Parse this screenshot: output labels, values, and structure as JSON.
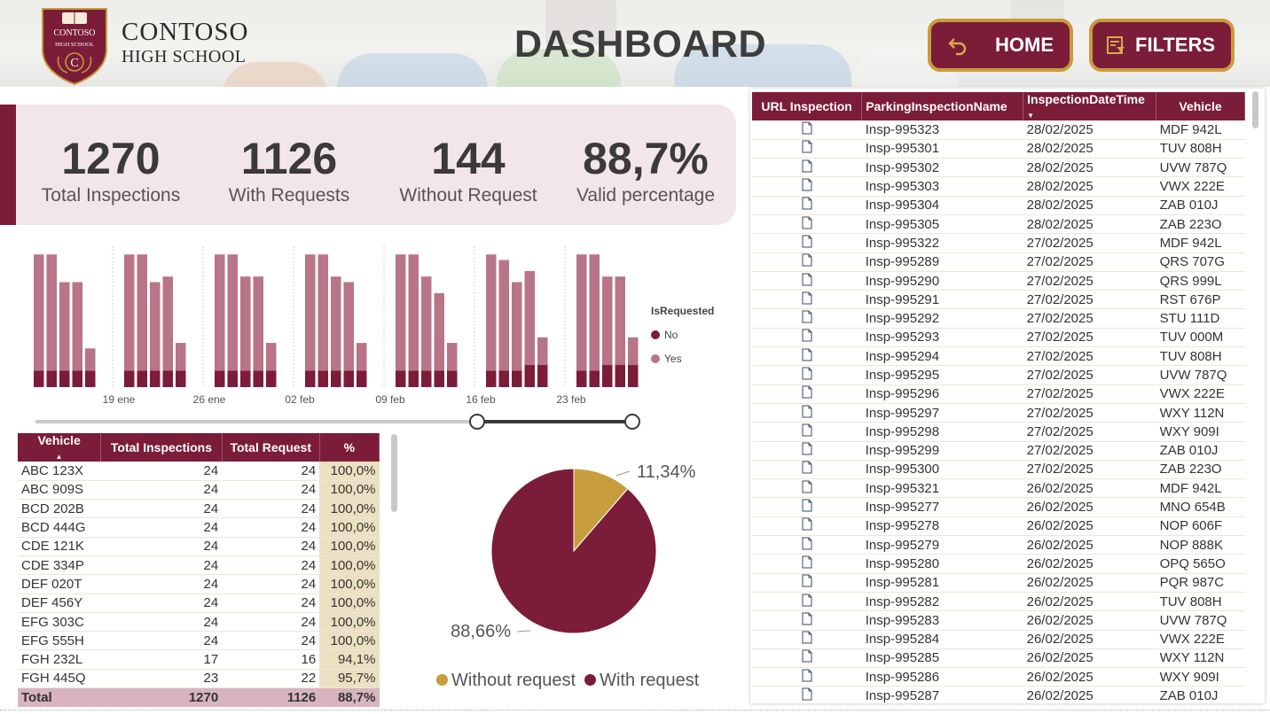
{
  "brand": {
    "line1": "CONTOSO",
    "line2": "HIGH SCHOOL",
    "crest_top": "CONTOSO",
    "crest_mid": "HIGH SCHOOL",
    "crest_letter": "C"
  },
  "header": {
    "title": "DASHBOARD",
    "home_label": "HOME",
    "filters_label": "FILTERS",
    "home_icon": "undo-arrow-icon",
    "filters_icon": "filter-icon"
  },
  "colors": {
    "maroon": "#7b1c38",
    "rose": "#b87587",
    "gold": "#c79d3e",
    "kpi_bg": "#f3e6e9",
    "pct_bg": "#ece0c2",
    "total_bg": "#d8b4bf"
  },
  "kpis": [
    {
      "value": "1270",
      "label": "Total Inspections"
    },
    {
      "value": "1126",
      "label": "With Requests"
    },
    {
      "value": "144",
      "label": "Without Request"
    },
    {
      "value": "88,7%",
      "label": "Valid percentage"
    }
  ],
  "bar_legend": {
    "title": "IsRequested",
    "items": [
      "No",
      "Yes"
    ]
  },
  "chart_data": [
    {
      "type": "bar",
      "stacked": true,
      "title": "",
      "legend_title": "IsRequested",
      "legend_position": "right",
      "x_tick_labels": [
        "19 ene",
        "26 ene",
        "02 feb",
        "09 feb",
        "16 feb",
        "23 feb"
      ],
      "groups": 7,
      "bars_per_group": 5,
      "series": [
        {
          "name": "No",
          "color": "#7b1c38",
          "values": [
            [
              3,
              3,
              3,
              3,
              3
            ],
            [
              3,
              3,
              3,
              3,
              3
            ],
            [
              3,
              3,
              3,
              3,
              3
            ],
            [
              3,
              3,
              3,
              3,
              3
            ],
            [
              3,
              3,
              3,
              3,
              3
            ],
            [
              3,
              3,
              3,
              4,
              4
            ],
            [
              3,
              3,
              4,
              4,
              4
            ]
          ]
        },
        {
          "name": "Yes",
          "color": "#b87587",
          "values": [
            [
              21,
              21,
              16,
              16,
              4
            ],
            [
              21,
              21,
              16,
              17,
              5
            ],
            [
              21,
              21,
              17,
              17,
              5
            ],
            [
              21,
              21,
              17,
              16,
              5
            ],
            [
              21,
              21,
              17,
              14,
              5
            ],
            [
              21,
              20,
              16,
              17,
              5
            ],
            [
              21,
              21,
              16,
              16,
              5
            ]
          ]
        }
      ],
      "ylim": [
        0,
        25
      ],
      "grid": false
    },
    {
      "type": "pie",
      "title": "",
      "slices": [
        {
          "name": "Without request",
          "value": 11.34,
          "label": "11,34%",
          "color": "#c79d3e"
        },
        {
          "name": "With request",
          "value": 88.66,
          "label": "88,66%",
          "color": "#7b1c38"
        }
      ],
      "legend_position": "bottom"
    }
  ],
  "vehicle_table": {
    "columns": [
      "Vehicle",
      "Total Inspections",
      "Total Request",
      "%"
    ],
    "rows": [
      [
        "ABC 123X",
        "24",
        "24",
        "100,0%"
      ],
      [
        "ABC 909S",
        "24",
        "24",
        "100,0%"
      ],
      [
        "BCD 202B",
        "24",
        "24",
        "100,0%"
      ],
      [
        "BCD 444G",
        "24",
        "24",
        "100,0%"
      ],
      [
        "CDE 121K",
        "24",
        "24",
        "100,0%"
      ],
      [
        "CDE 334P",
        "24",
        "24",
        "100,0%"
      ],
      [
        "DEF 020T",
        "24",
        "24",
        "100,0%"
      ],
      [
        "DEF 456Y",
        "24",
        "24",
        "100,0%"
      ],
      [
        "EFG 303C",
        "24",
        "24",
        "100,0%"
      ],
      [
        "EFG 555H",
        "24",
        "24",
        "100,0%"
      ],
      [
        "FGH 232L",
        "17",
        "16",
        "94,1%"
      ],
      [
        "FGH 445Q",
        "23",
        "22",
        "95,7%"
      ]
    ],
    "total": [
      "Total",
      "1270",
      "1126",
      "88,7%"
    ]
  },
  "inspection_table": {
    "columns": [
      "URL Inspection",
      "ParkingInspectionName",
      "InspectionDateTime",
      "Vehicle"
    ],
    "rows": [
      [
        "Insp-995323",
        "28/02/2025",
        "MDF 942L"
      ],
      [
        "Insp-995301",
        "28/02/2025",
        "TUV 808H"
      ],
      [
        "Insp-995302",
        "28/02/2025",
        "UVW 787Q"
      ],
      [
        "Insp-995303",
        "28/02/2025",
        "VWX 222E"
      ],
      [
        "Insp-995304",
        "28/02/2025",
        "ZAB 010J"
      ],
      [
        "Insp-995305",
        "28/02/2025",
        "ZAB 223O"
      ],
      [
        "Insp-995322",
        "27/02/2025",
        "MDF 942L"
      ],
      [
        "Insp-995289",
        "27/02/2025",
        "QRS 707G"
      ],
      [
        "Insp-995290",
        "27/02/2025",
        "QRS 999L"
      ],
      [
        "Insp-995291",
        "27/02/2025",
        "RST 676P"
      ],
      [
        "Insp-995292",
        "27/02/2025",
        "STU 111D"
      ],
      [
        "Insp-995293",
        "27/02/2025",
        "TUV 000M"
      ],
      [
        "Insp-995294",
        "27/02/2025",
        "TUV 808H"
      ],
      [
        "Insp-995295",
        "27/02/2025",
        "UVW 787Q"
      ],
      [
        "Insp-995296",
        "27/02/2025",
        "VWX 222E"
      ],
      [
        "Insp-995297",
        "27/02/2025",
        "WXY 112N"
      ],
      [
        "Insp-995298",
        "27/02/2025",
        "WXY 909I"
      ],
      [
        "Insp-995299",
        "27/02/2025",
        "ZAB 010J"
      ],
      [
        "Insp-995300",
        "27/02/2025",
        "ZAB 223O"
      ],
      [
        "Insp-995321",
        "26/02/2025",
        "MDF 942L"
      ],
      [
        "Insp-995277",
        "26/02/2025",
        "MNO 654B"
      ],
      [
        "Insp-995278",
        "26/02/2025",
        "NOP 606F"
      ],
      [
        "Insp-995279",
        "26/02/2025",
        "NOP 888K"
      ],
      [
        "Insp-995280",
        "26/02/2025",
        "OPQ 565O"
      ],
      [
        "Insp-995281",
        "26/02/2025",
        "PQR 987C"
      ],
      [
        "Insp-995282",
        "26/02/2025",
        "TUV 808H"
      ],
      [
        "Insp-995283",
        "26/02/2025",
        "UVW 787Q"
      ],
      [
        "Insp-995284",
        "26/02/2025",
        "VWX 222E"
      ],
      [
        "Insp-995285",
        "26/02/2025",
        "WXY 112N"
      ],
      [
        "Insp-995286",
        "26/02/2025",
        "WXY 909I"
      ],
      [
        "Insp-995287",
        "26/02/2025",
        "ZAB 010J"
      ]
    ]
  }
}
